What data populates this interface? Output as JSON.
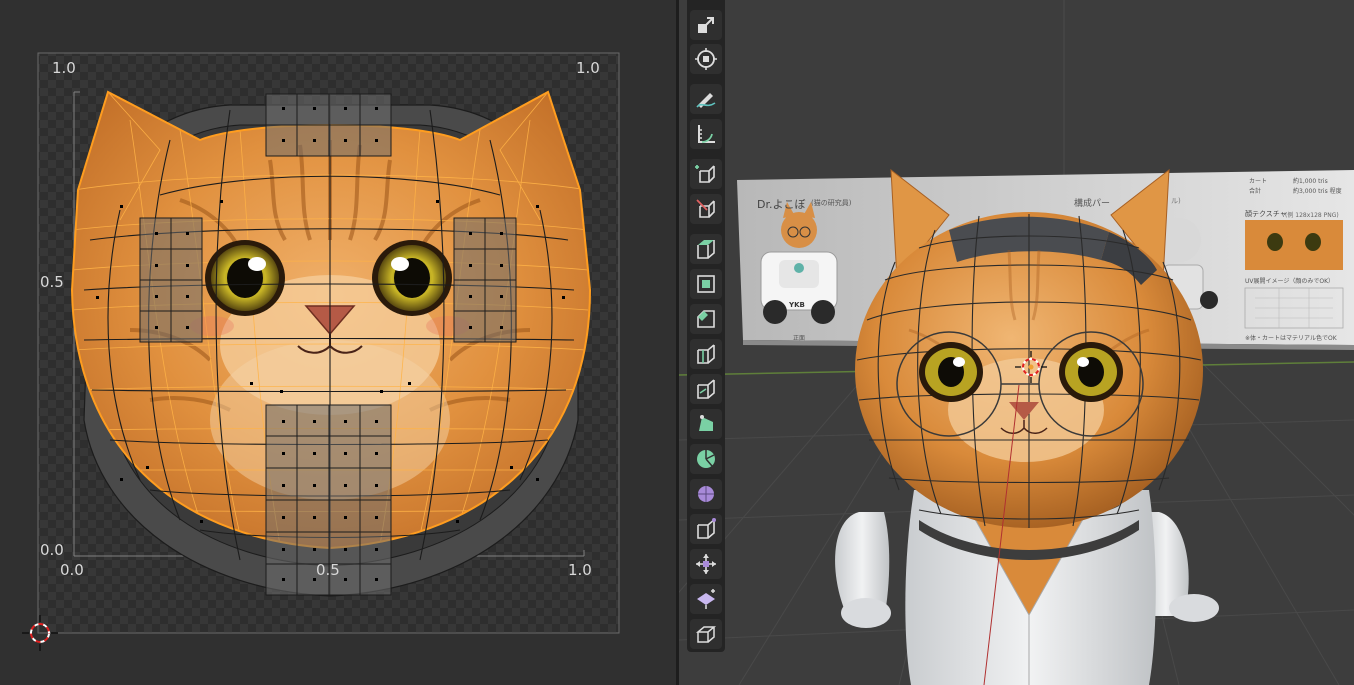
{
  "uv_editor": {
    "axis_labels": {
      "top_left": "1.0",
      "top_right": "1.0",
      "mid_left": "0.5",
      "bottom_left_y": "0.0",
      "bottom_left_x": "0.0",
      "bottom_mid": "0.5",
      "bottom_right": "1.0"
    }
  },
  "viewport": {
    "reference_sheet": {
      "title": "Dr.よこぼ",
      "title_note": "(猫の研究員)",
      "section": "構成パー",
      "stat_cart": "カート",
      "stat_cart_value": "約1,000 tris",
      "stat_total": "合計",
      "stat_total_value": "約3,000 tris 程度",
      "face_texture": "顔テクスチャ",
      "face_texture_note": "(例 128x128 PNG)",
      "uv_note": "UV展開イメージ（顔のみでOK）",
      "footer_note": "※体・カートはマテリアル色でOK",
      "front_label": "正面",
      "kart_badge": "YKB",
      "truncated_label": "ル)"
    }
  },
  "toolbar": {
    "tools": [
      "scale-tool",
      "transform-tool",
      "annotate-tool",
      "measure-tool",
      "add-cube-tool",
      "add-cube-cut-tool",
      "extrude-region-tool",
      "inset-faces-tool",
      "bevel-tool",
      "loop-cut-tool",
      "knife-tool",
      "poly-build-tool",
      "spin-tool",
      "smooth-tool",
      "randomize-tool",
      "edge-slide-tool",
      "shrink-fatten-tool",
      "shear-tool",
      "rip-region-tool"
    ]
  },
  "colors": {
    "fur_orange": "#d98a3a",
    "uv_selected": "#f0a030",
    "mesh_dark": "#4a4a4a",
    "background": "#303030",
    "viewport_bg": "#3d3d3d",
    "accent_green": "#7ad0a4",
    "accent_teal": "#5fc4c0",
    "accent_purple": "#a88ad8"
  }
}
